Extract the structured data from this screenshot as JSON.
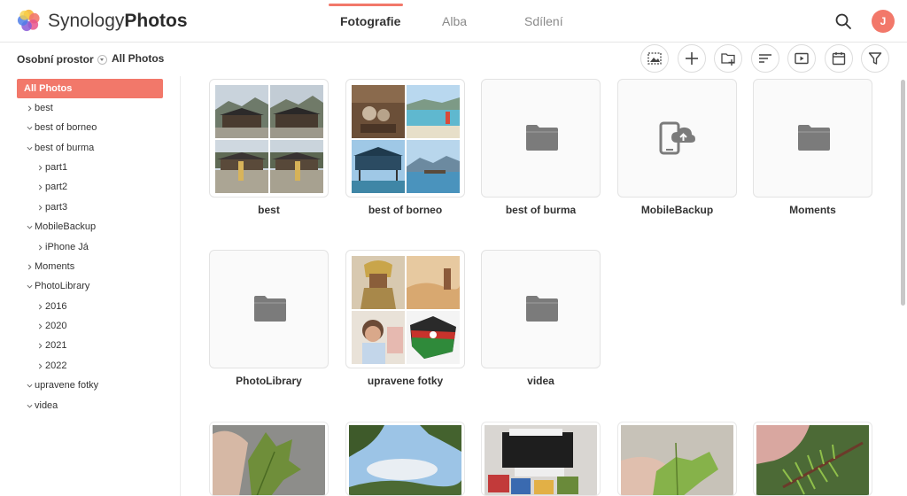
{
  "app": {
    "brand_light": "Synology",
    "brand_bold": "Photos",
    "user_initial": "J",
    "accent_color": "#f2786a"
  },
  "tabs": [
    {
      "label": "Fotografie",
      "active": true
    },
    {
      "label": "Alba",
      "active": false
    },
    {
      "label": "Sdílení",
      "active": false
    }
  ],
  "subheader": {
    "space": "Osobní prostor",
    "breadcrumb": "All Photos"
  },
  "toolbar": [
    "image-select-icon",
    "add-icon",
    "new-folder-icon",
    "sort-icon",
    "slideshow-icon",
    "calendar-icon",
    "filter-icon"
  ],
  "sidebar": {
    "active": "All Photos",
    "items": [
      {
        "label": "best",
        "expanded": false,
        "level": 0
      },
      {
        "label": "best of borneo",
        "expanded": true,
        "level": 0
      },
      {
        "label": "best of burma",
        "expanded": true,
        "level": 0
      },
      {
        "label": "part1",
        "expanded": false,
        "level": 1
      },
      {
        "label": "part2",
        "expanded": false,
        "level": 1
      },
      {
        "label": "part3",
        "expanded": false,
        "level": 1
      },
      {
        "label": "MobileBackup",
        "expanded": true,
        "level": 0
      },
      {
        "label": "iPhone Já",
        "expanded": false,
        "level": 1
      },
      {
        "label": "Moments",
        "expanded": false,
        "level": 0
      },
      {
        "label": "PhotoLibrary",
        "expanded": true,
        "level": 0
      },
      {
        "label": "2016",
        "expanded": false,
        "level": 1
      },
      {
        "label": "2020",
        "expanded": false,
        "level": 1
      },
      {
        "label": "2021",
        "expanded": false,
        "level": 1
      },
      {
        "label": "2022",
        "expanded": false,
        "level": 1
      },
      {
        "label": "upravene fotky",
        "expanded": true,
        "level": 0
      },
      {
        "label": "videa",
        "expanded": true,
        "level": 0
      }
    ]
  },
  "albums": [
    {
      "title": "best",
      "thumb": "collage"
    },
    {
      "title": "best of borneo",
      "thumb": "collage"
    },
    {
      "title": "best of burma",
      "thumb": "folder-icon"
    },
    {
      "title": "MobileBackup",
      "thumb": "mobile-backup-icon"
    },
    {
      "title": "Moments",
      "thumb": "folder-icon"
    },
    {
      "title": "PhotoLibrary",
      "thumb": "folder-icon"
    },
    {
      "title": "upravene fotky",
      "thumb": "collage"
    },
    {
      "title": "videa",
      "thumb": "folder-icon"
    }
  ]
}
